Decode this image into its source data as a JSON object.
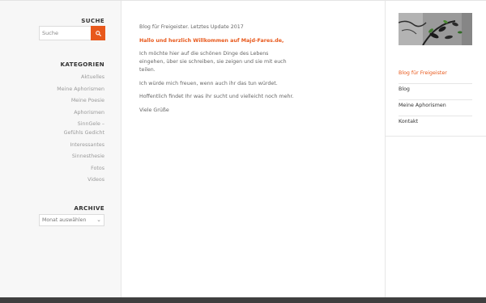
{
  "sidebar": {
    "search_title": "SUCHE",
    "search_placeholder": "Suche",
    "search_icon": "magnifier-icon",
    "categories_title": "KATEGORIEN",
    "categories": [
      "Aktuelles",
      "Meine Aphorismen",
      "Meine Poesie",
      "Aphorismen",
      "SinnGele – Gefühls Gedicht",
      "Interessantes",
      "Sinnesthesie",
      "Fotos",
      "Videos"
    ],
    "archive_title": "ARCHIVE",
    "archive_select": "Monat auswählen"
  },
  "content": {
    "intro": "Blog für Freigeister. Letztes Update 2017",
    "greeting": "Hallo und herzlich Willkommen auf Majd-Fares.de,",
    "p1": "Ich möchte hier auf die schönen Dinge des Lebens eingehen, über sie schreiben, sie zeigen und sie mit euch teilen.",
    "p2": "Ich würde mich freuen, wenn auch ihr das tun würdet.",
    "p3": "Hoffentlich findet Ihr was ihr sucht und vielleicht noch mehr.",
    "p4": "Viele Grüße"
  },
  "nav": {
    "items": [
      "Blog für Freigeister",
      "Blog",
      "Meine Aphorismen",
      "Kontakt"
    ]
  },
  "colors": {
    "accent": "#e8581b",
    "sidebar_bg": "#f7f7f7",
    "footer": "#3f3f3f"
  }
}
